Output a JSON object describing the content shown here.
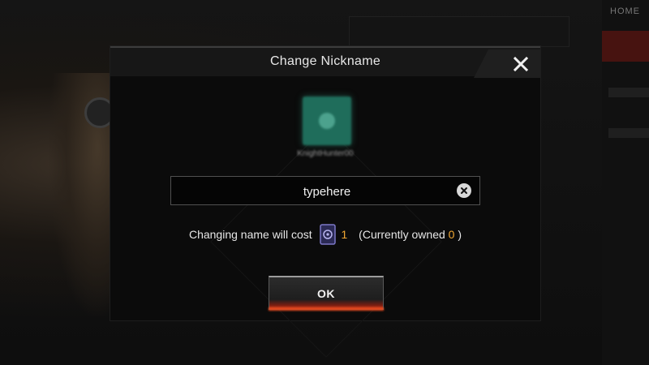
{
  "background": {
    "menu_header": "HOME"
  },
  "dialog": {
    "title": "Change Nickname",
    "username": "KnightHunter00"
  },
  "name_input": {
    "value": "typehere"
  },
  "cost": {
    "label": "Changing name will cost",
    "amount": "1",
    "owned_prefix": "(Currently owned",
    "owned_amount": "0",
    "owned_suffix": ")"
  },
  "ok_button": {
    "label": "OK"
  },
  "colors": {
    "accent_orange": "#f2a833",
    "ok_red": "#c83a1c",
    "avatar_green": "#1f6d5b"
  },
  "icons": {
    "close": "close-icon",
    "clear": "clear-input-icon",
    "token": "rename-token-icon"
  }
}
